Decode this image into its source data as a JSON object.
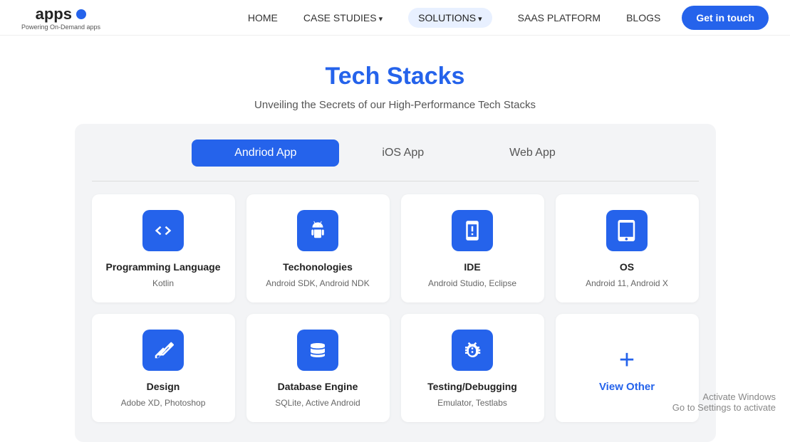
{
  "nav": {
    "logo_text": "apps",
    "logo_sub": "Powering On-Demand apps",
    "links": [
      {
        "label": "HOME",
        "active": false
      },
      {
        "label": "CASE STUDIES",
        "active": false,
        "arrow": true
      },
      {
        "label": "SOLUTIONS",
        "active": true,
        "arrow": true
      },
      {
        "label": "SAAS PLATFORM",
        "active": false
      },
      {
        "label": "BLOGS",
        "active": false
      }
    ],
    "cta_label": "Get in touch"
  },
  "hero": {
    "title_plain": "Tech ",
    "title_accent": "Stacks",
    "subtitle": "Unveiling the Secrets of our High-Performance Tech Stacks"
  },
  "tabs": [
    {
      "label": "Andriod App",
      "active": true
    },
    {
      "label": "iOS App",
      "active": false
    },
    {
      "label": "Web App",
      "active": false
    }
  ],
  "cards": [
    {
      "id": "programming-language",
      "title": "Programming Language",
      "desc": "Kotlin",
      "icon": "code"
    },
    {
      "id": "technologies",
      "title": "Techonologies",
      "desc": "Android SDK, Android NDK",
      "icon": "android"
    },
    {
      "id": "ide",
      "title": "IDE",
      "desc": "Android Studio, Eclipse",
      "icon": "mobile"
    },
    {
      "id": "os",
      "title": "OS",
      "desc": "Android 11, Android X",
      "icon": "tablet"
    },
    {
      "id": "design",
      "title": "Design",
      "desc": "Adobe XD, Photoshop",
      "icon": "design"
    },
    {
      "id": "database-engine",
      "title": "Database Engine",
      "desc": "SQLite, Active Android",
      "icon": "database"
    },
    {
      "id": "testing-debugging",
      "title": "Testing/Debugging",
      "desc": "Emulator, Testlabs",
      "icon": "bug"
    }
  ],
  "view_other": {
    "plus": "+",
    "label": "View Other"
  },
  "watermark": {
    "line1": "Activate Windows",
    "line2": "Go to Settings to activate"
  }
}
